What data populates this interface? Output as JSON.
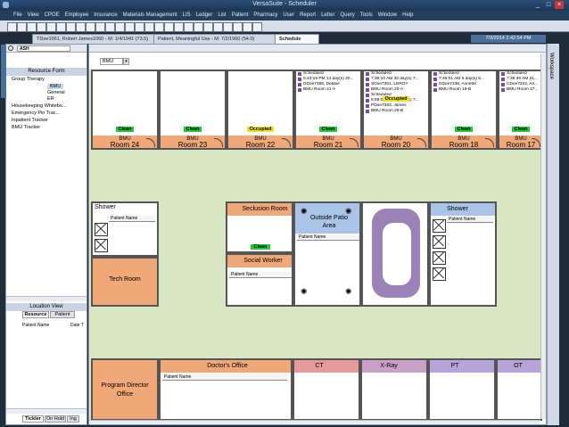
{
  "window": {
    "title": "VersaSuite - Scheduler"
  },
  "menu": [
    "File",
    "View",
    "CPOE",
    "Employee",
    "Insurance",
    "Materials Management",
    "LIS",
    "Ledger",
    "List",
    "Patient",
    "Pharmacy",
    "User",
    "Report",
    "Letter",
    "Query",
    "Tools",
    "Window",
    "Help"
  ],
  "doc_tabs": [
    {
      "label": "TDoe1061, Robert James1060 - M: 1/4/1941 (73.5)"
    },
    {
      "label": "Patient, Meaningful Use - M: 7/2/1960 (54.0)"
    },
    {
      "label": "Schedule"
    }
  ],
  "datetime": "7/3/2014 2:42:54 PM",
  "unit_select": "BMU",
  "left_panel": {
    "search_value": "ASH",
    "resource_form_header": "Resource Form",
    "tree": [
      "Group Therapy",
      "BMU",
      "General",
      "ER",
      "Housekeeping Whitebo...",
      "Emergency Pin Trac...",
      "Inpatient Tracker",
      "BMU Tracker"
    ],
    "location_view_header": "Location View",
    "tabs": [
      "Resource",
      "Patient"
    ],
    "columns": [
      "Patient Name",
      "Date T"
    ],
    "bottom_tabs": [
      "Tickler",
      "On Hold",
      "Ing"
    ]
  },
  "right_strip_label": "Workspace",
  "rooms_top": [
    {
      "unit": "BMU",
      "name": "Room 24",
      "status": "Clean",
      "sched": []
    },
    {
      "unit": "BMU",
      "name": "Room 23",
      "status": "Clean",
      "sched": []
    },
    {
      "unit": "BMU",
      "name": "Room 22",
      "status": "Occupied",
      "sched": []
    },
    {
      "unit": "BMU",
      "name": "Room 21",
      "status": "Clean",
      "sched": [
        "Scheduled",
        "5:43:19 PM 14 day(s) 20...",
        "DDoe7358, Debbie",
        "BMU Room 21-A"
      ]
    },
    {
      "unit": "BMU",
      "name": "Room 20",
      "status": "Occupied",
      "sched": [
        "Scheduled",
        "7:36:10 AM 33 day(s) 7...",
        "SDoe7361, LEROY",
        "BMU Room 20-A",
        "Scheduled",
        "6:59:00 AM 19 day(s) 7...",
        "PDoe7383, James",
        "BMU Room 20-B"
      ]
    },
    {
      "unit": "BMU",
      "name": "Room 18",
      "status": "Clean",
      "sched": [
        "Scheduled",
        "7:46:01 AM 6 day(s) 6...",
        "DDoe7338, Annette",
        "BMU Room 18-B"
      ]
    },
    {
      "unit": "BMU",
      "name": "Room 17",
      "status": "Clean",
      "sched": [
        "Scheduled",
        "7:35:39 AM 21...",
        "CDoe7322, An...",
        "BMU Room 17..."
      ]
    }
  ],
  "middle_rooms": {
    "shower_left": {
      "title": "Shower",
      "col": "Patient Name"
    },
    "seclusion": {
      "title": "Seclusion Room",
      "status": "Clean"
    },
    "outside_patio": {
      "title": "Outside Patio Area",
      "col": "Patient Name"
    },
    "social_worker": {
      "title": "Social Worker",
      "col": "Patient Name"
    },
    "tech_room": {
      "title": "Tech Room"
    },
    "shower_right": {
      "title": "Shower",
      "col": "Patient Name"
    }
  },
  "bottom_rooms": [
    {
      "title": "Program Director Office"
    },
    {
      "title": "Doctor's Office",
      "col": "Patient Name"
    },
    {
      "title": "CT"
    },
    {
      "title": "X-Ray"
    },
    {
      "title": "PT"
    },
    {
      "title": "OT"
    }
  ],
  "colors": {
    "room_bar": "#f0a878",
    "clean": "#22c93a",
    "occupied": "#f0e020",
    "floor": "#d9e6c4",
    "titlebar": "#2b4f78",
    "ct": "#e69a9a",
    "xray": "#c8a0c8",
    "pt": "#b7a4d8"
  }
}
